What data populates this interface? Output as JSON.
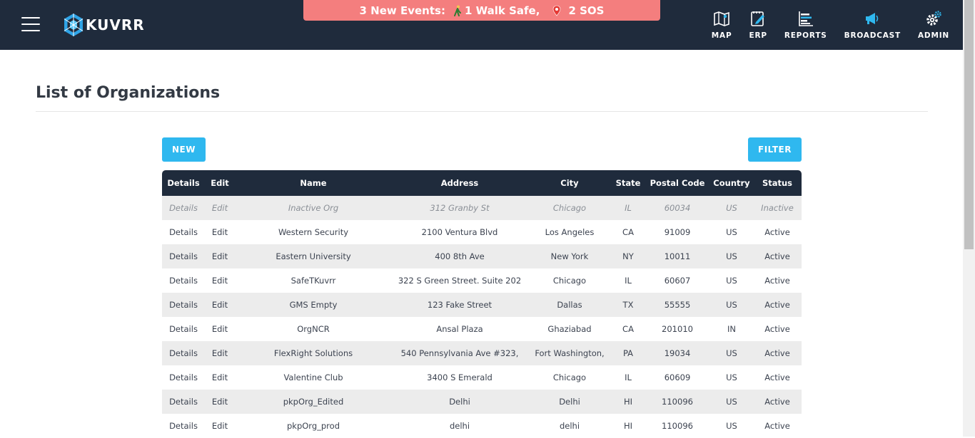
{
  "header": {
    "logo_text": "KUVRR",
    "events": {
      "prefix": "3 New Events:",
      "walk_safe": "1 Walk Safe,",
      "sos": "2 SOS"
    },
    "nav": [
      {
        "label": "MAP",
        "icon": "map-icon"
      },
      {
        "label": "ERP",
        "icon": "erp-icon"
      },
      {
        "label": "REPORTS",
        "icon": "reports-icon"
      },
      {
        "label": "BROADCAST",
        "icon": "broadcast-icon"
      },
      {
        "label": "ADMIN",
        "icon": "admin-gear-icon"
      }
    ]
  },
  "page": {
    "title": "List of Organizations",
    "new_button": "NEW",
    "filter_button": "FILTER"
  },
  "table": {
    "columns": [
      "Details",
      "Edit",
      "Name",
      "Address",
      "City",
      "State",
      "Postal Code",
      "Country",
      "Status"
    ],
    "rows": [
      [
        "Details",
        "Edit",
        "Inactive Org",
        "312 Granby St",
        "Chicago",
        "IL",
        "60034",
        "US",
        "Inactive"
      ],
      [
        "Details",
        "Edit",
        "Western Security",
        "2100 Ventura Blvd",
        "Los Angeles",
        "CA",
        "91009",
        "US",
        "Active"
      ],
      [
        "Details",
        "Edit",
        "Eastern University",
        "400 8th Ave",
        "New York",
        "NY",
        "10011",
        "US",
        "Active"
      ],
      [
        "Details",
        "Edit",
        "SafeTKuvrr",
        "322 S Green Street. Suite 202",
        "Chicago",
        "IL",
        "60607",
        "US",
        "Active"
      ],
      [
        "Details",
        "Edit",
        "GMS Empty",
        "123 Fake Street",
        "Dallas",
        "TX",
        "55555",
        "US",
        "Active"
      ],
      [
        "Details",
        "Edit",
        "OrgNCR",
        "Ansal Plaza",
        "Ghaziabad",
        "CA",
        "201010",
        "IN",
        "Active"
      ],
      [
        "Details",
        "Edit",
        "FlexRight Solutions",
        "540 Pennsylvania Ave #323,",
        "Fort Washington,",
        "PA",
        "19034",
        "US",
        "Active"
      ],
      [
        "Details",
        "Edit",
        "Valentine Club",
        "3400 S Emerald",
        "Chicago",
        "IL",
        "60609",
        "US",
        "Active"
      ],
      [
        "Details",
        "Edit",
        "pkpOrg_Edited",
        "Delhi",
        "Delhi",
        "HI",
        "110096",
        "US",
        "Active"
      ],
      [
        "Details",
        "Edit",
        "pkpOrg_prod",
        "delhi",
        "delhi",
        "HI",
        "110096",
        "US",
        "Active"
      ]
    ]
  },
  "colors": {
    "header_bg": "#1f2b3c",
    "accent": "#2fb8ef",
    "banner": "#f47e7e"
  }
}
